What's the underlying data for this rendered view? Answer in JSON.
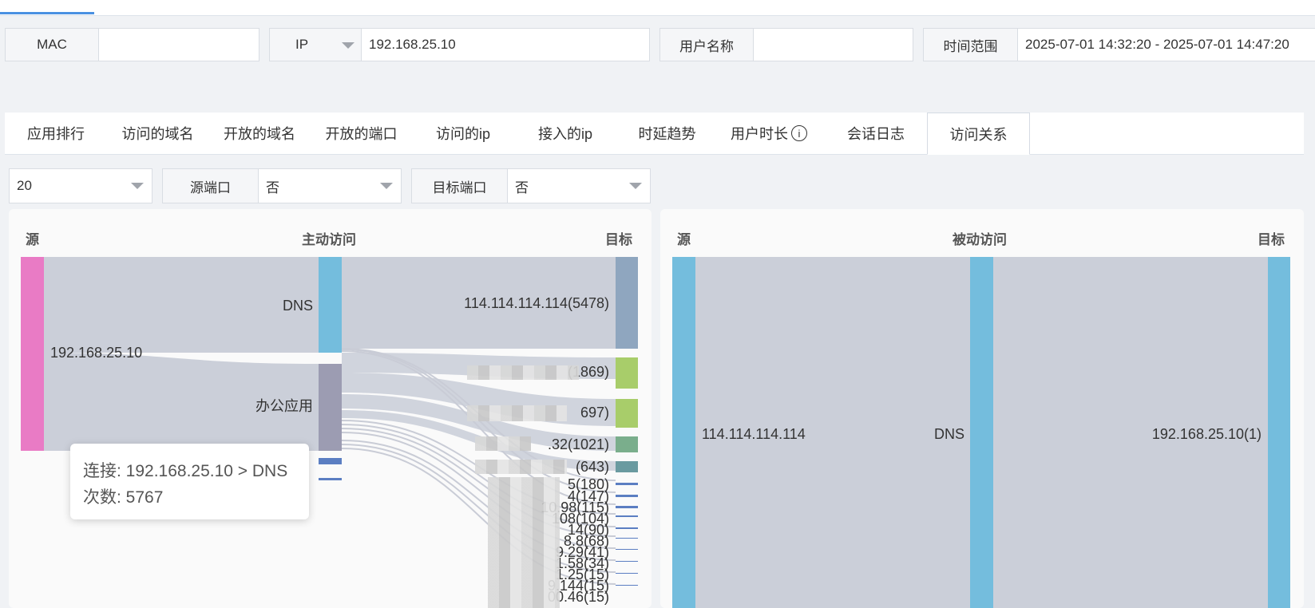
{
  "filters": {
    "mac": {
      "label": "MAC",
      "value": ""
    },
    "ip": {
      "type_label": "IP",
      "value": "192.168.25.10"
    },
    "username": {
      "label": "用户名称",
      "value": ""
    },
    "time_range": {
      "label": "时间范围",
      "value": "2025-07-01 14:32:20 - 2025-07-01 14:47:20"
    }
  },
  "tabs": [
    "应用排行",
    "访问的域名",
    "开放的域名",
    "开放的端口",
    "访问的ip",
    "接入的ip",
    "时延趋势",
    "用户时长",
    "会话日志",
    "访问关系"
  ],
  "active_tab": "访问关系",
  "selectors": {
    "topn": "20",
    "src_port": {
      "label": "源端口",
      "value": "否"
    },
    "dst_port": {
      "label": "目标端口",
      "value": "否"
    }
  },
  "active_panel": {
    "source_header": "源",
    "title": "主动访问",
    "target_header": "目标",
    "source_node": "192.168.25.10",
    "app_nodes": [
      "DNS",
      "办公应用"
    ],
    "target_nodes": [
      "114.114.114.114(5478)",
      "(1869)",
      "697)",
      ".32(1021)",
      "(643)",
      "5(180)",
      "4(147)",
      "10.98(115)",
      "108(104)",
      "14(90)",
      "8.8(68)",
      "9.29(41)",
      "1.58(34)",
      "1.25(15)",
      "9.144(15)",
      "00.46(15)"
    ],
    "tooltip": {
      "connection": "连接: 192.168.25.10 > DNS",
      "count": "次数: 5767"
    }
  },
  "passive_panel": {
    "source_header": "源",
    "title": "被动访问",
    "target_header": "目标",
    "source_node": "114.114.114.114",
    "app_node": "DNS",
    "target_node": "192.168.25.10(1)"
  },
  "colors": {
    "pink": "#e97bc5",
    "dns": "#74bddd",
    "office": "#9c9cb2",
    "link": "#c8ccd6",
    "target_dns": "#8fa6bf",
    "green": "#a8cd6a",
    "teal": "#7aae8c",
    "blue": "#5b7ec2"
  }
}
